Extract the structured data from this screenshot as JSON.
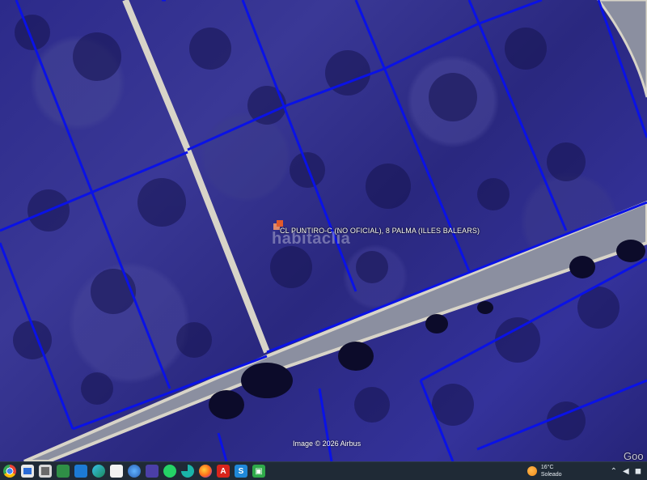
{
  "map": {
    "address_label": "CL PUNTIRO-C (NO OFICIAL), 8  PALMA (ILLES BALEARS)",
    "watermark": "habitaclia",
    "attribution": "Image © 2026 Airbus",
    "provider_mark": "Goo",
    "parcel_line_color": "#0a12e6",
    "road_color": "#d8d4c8"
  },
  "taskbar": {
    "apps": [
      {
        "name": "chrome-icon"
      },
      {
        "name": "app-icon-1"
      },
      {
        "name": "app-icon-2"
      },
      {
        "name": "app-icon-3"
      },
      {
        "name": "app-icon-4"
      },
      {
        "name": "edge-icon"
      },
      {
        "name": "file-icon"
      },
      {
        "name": "app-icon-5"
      },
      {
        "name": "save-icon"
      },
      {
        "name": "whatsapp-icon"
      },
      {
        "name": "app-icon-6"
      },
      {
        "name": "firefox-icon"
      },
      {
        "name": "acrobat-icon"
      },
      {
        "name": "app-icon-7"
      },
      {
        "name": "app-icon-8"
      }
    ],
    "weather": {
      "temperature": "16°C",
      "condition": "Soleado"
    }
  }
}
